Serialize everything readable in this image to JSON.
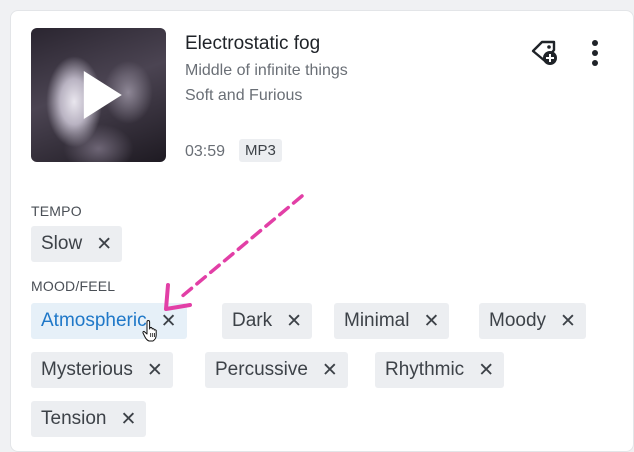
{
  "track": {
    "title": "Electrostatic fog",
    "album": "Middle of infinite things",
    "artist": "Soft and Furious",
    "duration": "03:59",
    "format": "MP3"
  },
  "icons": {
    "play": "play-icon",
    "add_tag": "tag-add-icon",
    "more": "more-vertical-icon",
    "remove": "close-icon",
    "cursor": "hand-pointer-icon"
  },
  "sections": {
    "tempo": {
      "label": "TEMPO",
      "tags": [
        "Slow"
      ]
    },
    "mood": {
      "label": "MOOD/FEEL",
      "tags": [
        "Atmospheric",
        "Dark",
        "Minimal",
        "Moody",
        "Mysterious",
        "Percussive",
        "Rhythmic",
        "Tension"
      ]
    }
  },
  "remove_glyph": "✕",
  "colors": {
    "active_tag_text": "#1f78c8",
    "annotation_arrow": "#e23fa6",
    "chip_background": "#eceef1"
  }
}
